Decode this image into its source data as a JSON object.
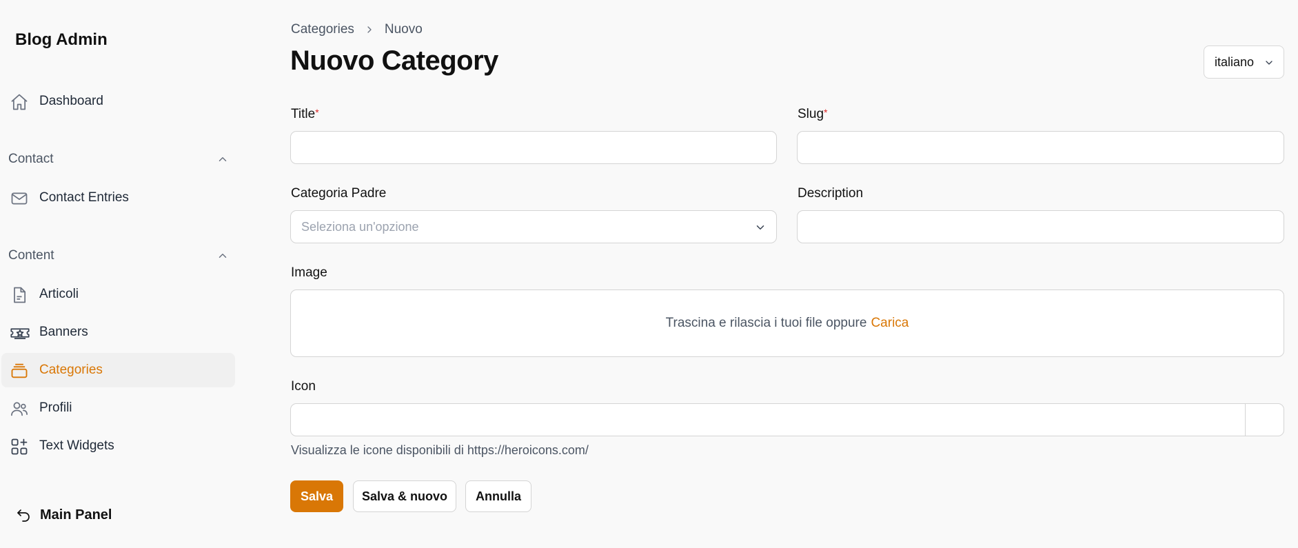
{
  "sidebar": {
    "brand": "Blog Admin",
    "dashboard": "Dashboard",
    "groups": [
      {
        "label": "Contact",
        "items": [
          "Contact Entries"
        ]
      },
      {
        "label": "Content",
        "items": [
          "Articoli",
          "Banners",
          "Categories",
          "Profili",
          "Text Widgets"
        ]
      }
    ],
    "active_item": "Categories",
    "main_panel": "Main Panel"
  },
  "header": {
    "breadcrumbs": [
      "Categories",
      "Nuovo"
    ],
    "title": "Nuovo Category",
    "locale": "italiano"
  },
  "form": {
    "title_label": "Title",
    "slug_label": "Slug",
    "required_mark": "*",
    "parent_label": "Categoria Padre",
    "parent_placeholder": "Seleziona un'opzione",
    "description_label": "Description",
    "image_label": "Image",
    "dropzone_text": "Trascina e rilascia i tuoi file oppure",
    "dropzone_upload": "Carica",
    "icon_label": "Icon",
    "icon_hint": "Visualizza le icone disponibili di https://heroicons.com/"
  },
  "actions": {
    "save": "Salva",
    "save_new": "Salva & nuovo",
    "cancel": "Annulla"
  },
  "colors": {
    "accent": "#d97706",
    "required": "#dc2626"
  }
}
